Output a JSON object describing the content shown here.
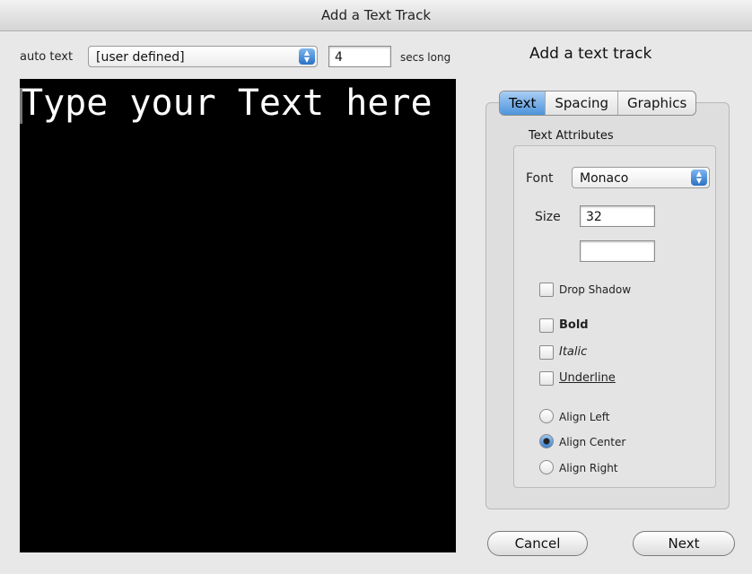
{
  "window": {
    "title": "Add a Text Track"
  },
  "toolbar": {
    "auto_text_label": "auto text",
    "auto_text_value": "[user defined]",
    "duration_value": "4",
    "duration_unit": "secs long"
  },
  "preview": {
    "text": "Type your Text here"
  },
  "panel": {
    "heading": "Add a text track",
    "tabs": [
      {
        "label": "Text",
        "selected": true
      },
      {
        "label": "Spacing",
        "selected": false
      },
      {
        "label": "Graphics",
        "selected": false
      }
    ],
    "group_title": "Text Attributes",
    "font_label": "Font",
    "font_value": "Monaco",
    "size_label": "Size",
    "size_value": "32",
    "color_value": "",
    "drop_shadow": {
      "label": "Drop Shadow",
      "checked": false
    },
    "bold": {
      "label": "Bold",
      "checked": false
    },
    "italic": {
      "label": "Italic",
      "checked": false
    },
    "underline": {
      "label": "Underline",
      "checked": false
    },
    "align_left": {
      "label": "Align Left",
      "selected": false
    },
    "align_center": {
      "label": "Align Center",
      "selected": true
    },
    "align_right": {
      "label": "Align Right",
      "selected": false
    }
  },
  "buttons": {
    "cancel": "Cancel",
    "next": "Next"
  }
}
